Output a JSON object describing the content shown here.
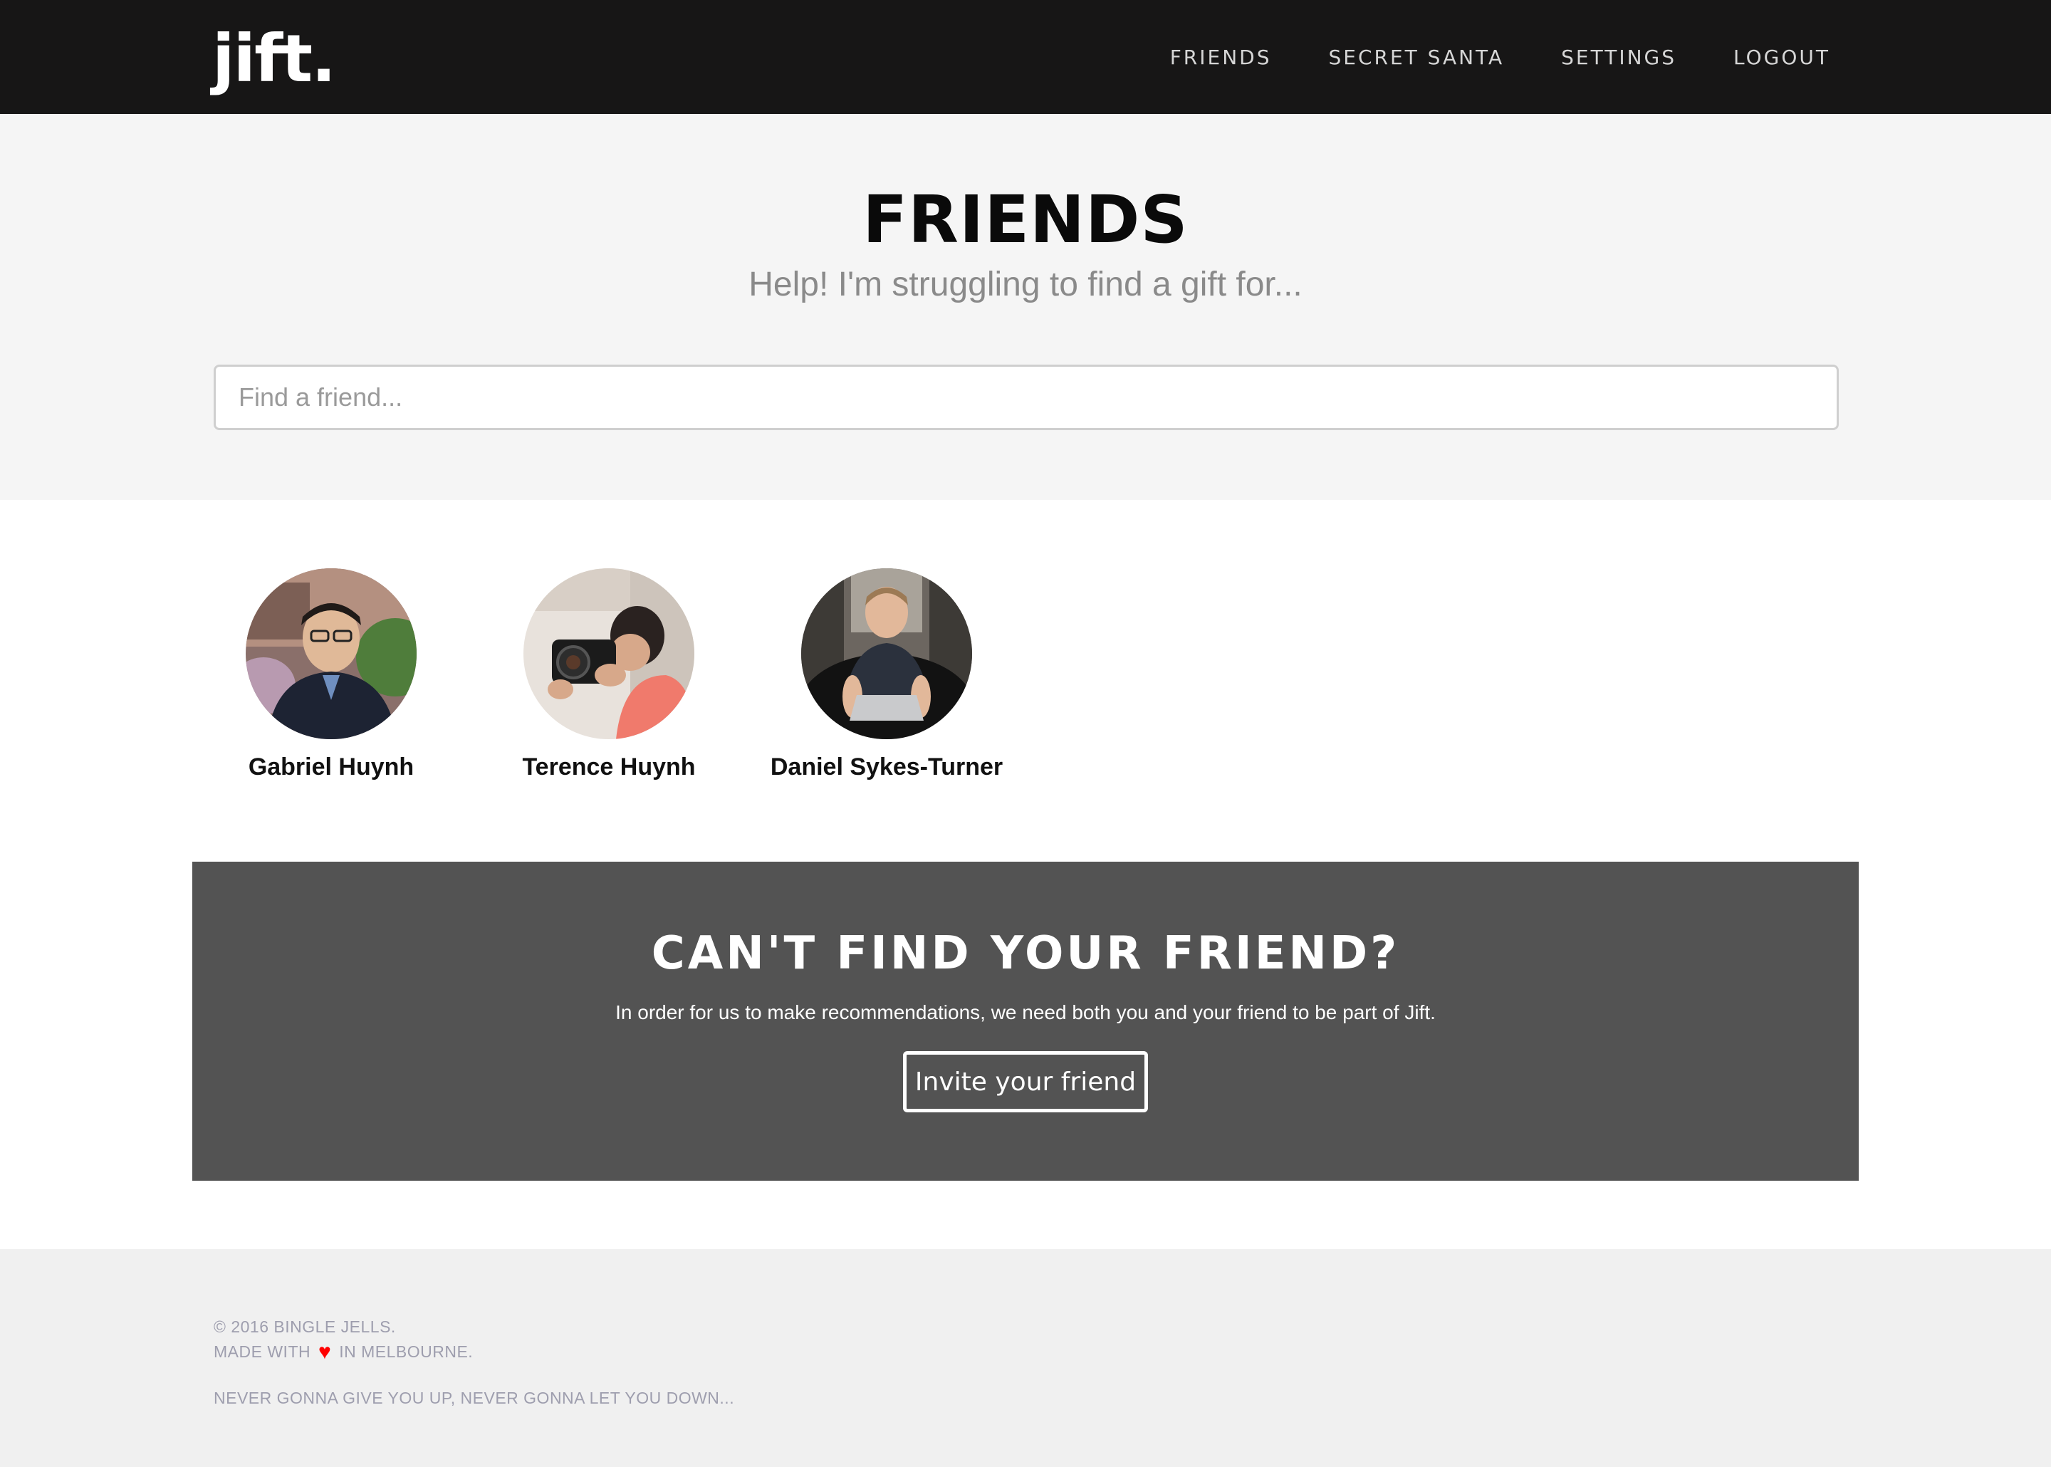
{
  "brand": {
    "logo_text": "jift."
  },
  "nav": {
    "items": [
      {
        "label": "FRIENDS"
      },
      {
        "label": "SECRET SANTA"
      },
      {
        "label": "SETTINGS"
      },
      {
        "label": "LOGOUT"
      }
    ]
  },
  "hero": {
    "title": "FRIENDS",
    "subtitle": "Help! I'm struggling to find a gift for...",
    "search": {
      "placeholder": "Find a friend...",
      "value": ""
    }
  },
  "friends": [
    {
      "name": "Gabriel Huynh",
      "avatar": "photo-avatar"
    },
    {
      "name": "Terence Huynh",
      "avatar": "photo-avatar"
    },
    {
      "name": "Daniel Sykes-Turner",
      "avatar": "photo-avatar"
    }
  ],
  "invite": {
    "title": "CAN'T FIND YOUR FRIEND?",
    "text": "In order for us to make recommendations, we need both you and your friend to be part of Jift.",
    "button_label": "Invite your friend"
  },
  "footer": {
    "copyright": "© 2016 BINGLE JELLS.",
    "made_with_prefix": "MADE WITH",
    "made_with_icon": "heart-icon",
    "made_with_suffix": "IN MELBOURNE.",
    "tagline": "NEVER GONNA GIVE YOU UP, NEVER GONNA LET YOU DOWN..."
  },
  "colors": {
    "navbar_bg": "#171616",
    "hero_bg": "#f5f5f5",
    "invite_bg": "#535353",
    "footer_bg": "#f0f0f0",
    "heart": "#ff0000"
  }
}
